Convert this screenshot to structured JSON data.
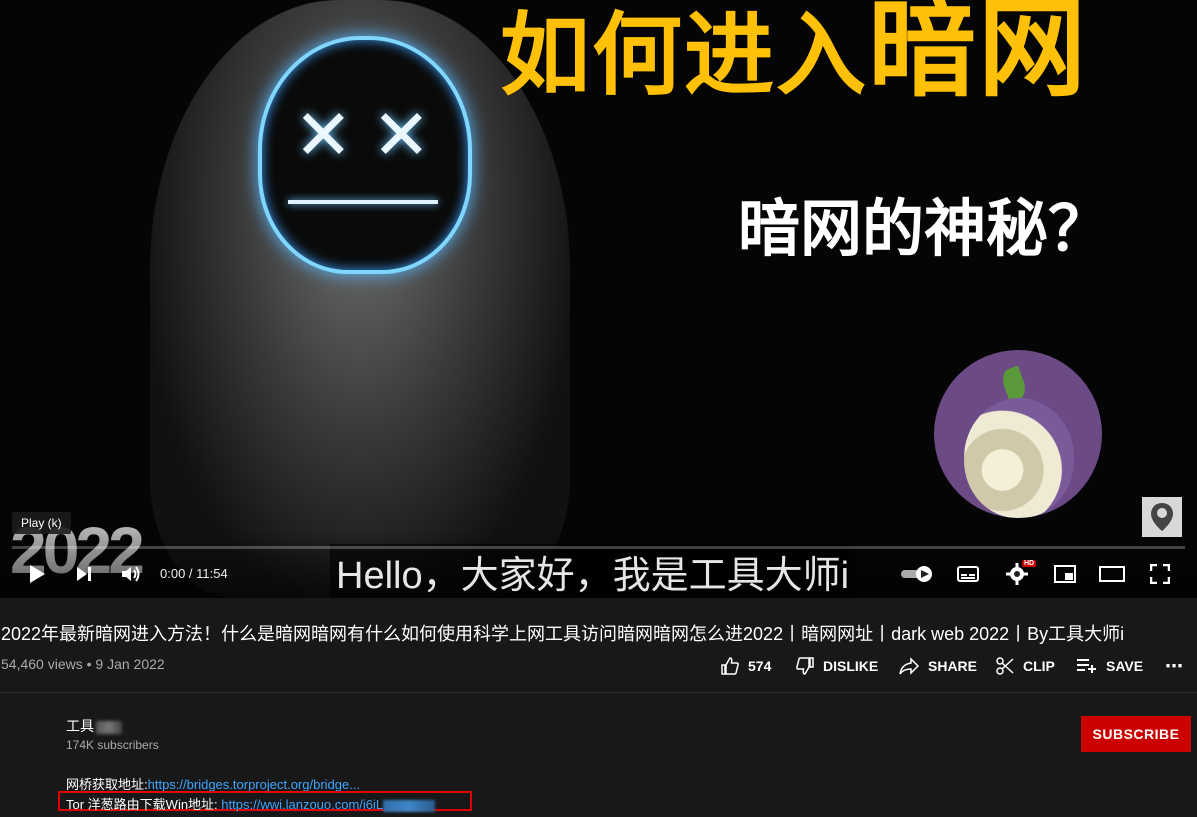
{
  "thumbnail": {
    "title_main": "如何进入",
    "title_big": "暗网",
    "subtitle": "暗网的神秘？",
    "year_badge": "2022"
  },
  "player": {
    "tooltip": "Play (k)",
    "caption": "Hello，大家好，我是工具大师i",
    "time_current": "0:00",
    "time_sep": " / ",
    "time_total": "11:54",
    "hd_badge": "HD",
    "progress": 0
  },
  "video": {
    "title": "2022年最新暗网进入方法！什么是暗网暗网有什么如何使用科学上网工具访问暗网暗网怎么进2022丨暗网网址丨dark web 2022丨By工具大师i",
    "views": "54,460 views",
    "dot": " • ",
    "date": "9 Jan 2022"
  },
  "actions": {
    "like_count": "574",
    "dislike_label": "DISLIKE",
    "share_label": "SHARE",
    "clip_label": "CLIP",
    "save_label": "SAVE",
    "more": "⋯"
  },
  "channel": {
    "name": "工具",
    "subscribers": "174K subscribers",
    "subscribe_label": "SUBSCRIBE"
  },
  "description": {
    "line1_text": "网桥获取地址:",
    "line1_link": "https://bridges.torproject.org/bridge...",
    "line2_text": "Tor 洋葱路由下载Win地址: ",
    "line2_link": "https://wwi.lanzouo.com/i6iL"
  },
  "colors": {
    "accent_red": "#cc0000",
    "link_blue": "#3ea6ff",
    "title_yellow": "#ffc107"
  }
}
